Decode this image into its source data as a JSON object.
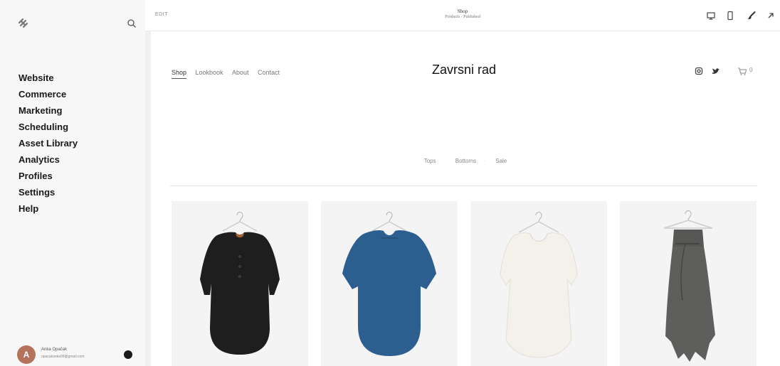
{
  "sidebar": {
    "nav": [
      "Website",
      "Commerce",
      "Marketing",
      "Scheduling",
      "Asset Library",
      "Analytics",
      "Profiles",
      "Settings",
      "Help"
    ],
    "user": {
      "initial": "A",
      "name": "Anka Opačak",
      "email": "opacakanka09@gmail.com"
    }
  },
  "topbar": {
    "edit_label": "EDIT",
    "page_title": "Shop",
    "page_status": "Products · Published",
    "icons": [
      "desktop-icon",
      "mobile-icon",
      "brush-icon",
      "expand-icon"
    ]
  },
  "site": {
    "nav": [
      "Shop",
      "Lookbook",
      "About",
      "Contact"
    ],
    "title": "Zavrsni rad",
    "cart_count": "0",
    "categories": [
      "Tops",
      "Bottoms",
      "Sale"
    ],
    "products": [
      {
        "kind": "tunic",
        "color": "#1e1e1e",
        "accent": "#a0603a"
      },
      {
        "kind": "tunic",
        "color": "#2c5e8f"
      },
      {
        "kind": "top",
        "color": "#f4f1ea"
      },
      {
        "kind": "trousers",
        "color": "#5e5e5c"
      }
    ]
  },
  "colors": {
    "sidebar_bg": "#f7f7f7",
    "product_bg": "#f4f4f4",
    "avatar": "#b4735a"
  }
}
